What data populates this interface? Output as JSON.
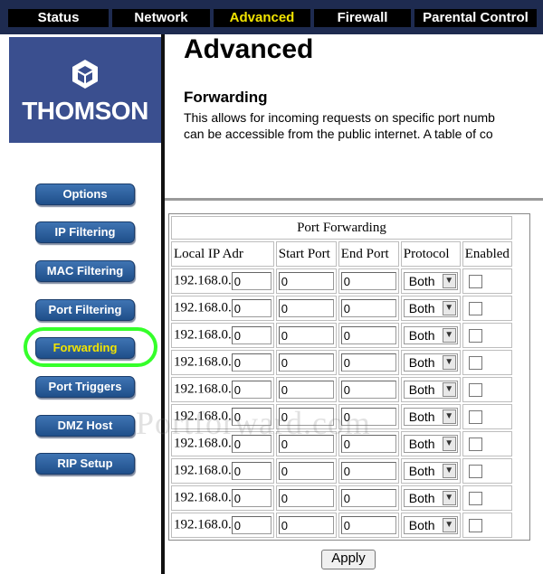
{
  "topnav": {
    "tabs": [
      {
        "label": "Status",
        "active": false
      },
      {
        "label": "Network",
        "active": false
      },
      {
        "label": "Advanced",
        "active": true
      },
      {
        "label": "Firewall",
        "active": false
      },
      {
        "label": "Parental Control",
        "active": false
      }
    ],
    "active_color": "#f2e400"
  },
  "brand": {
    "name": "THOMSON"
  },
  "sidebar": {
    "items": [
      {
        "label": "Options"
      },
      {
        "label": "IP Filtering"
      },
      {
        "label": "MAC Filtering"
      },
      {
        "label": "Port Filtering"
      },
      {
        "label": "Forwarding",
        "current": true
      },
      {
        "label": "Port Triggers"
      },
      {
        "label": "DMZ Host"
      },
      {
        "label": "RIP Setup"
      }
    ]
  },
  "main": {
    "title": "Advanced",
    "section_title": "Forwarding",
    "description_line1": "This allows for incoming requests on specific port numb",
    "description_line2": "can be accessible from the public internet.  A table of co"
  },
  "table": {
    "caption": "Port Forwarding",
    "headers": [
      "Local IP Adr",
      "Start Port",
      "End Port",
      "Protocol",
      "Enabled"
    ],
    "ip_prefix": "192.168.0.",
    "rows": [
      {
        "ip_last": "0",
        "start": "0",
        "end": "0",
        "protocol": "Both",
        "enabled": false
      },
      {
        "ip_last": "0",
        "start": "0",
        "end": "0",
        "protocol": "Both",
        "enabled": false
      },
      {
        "ip_last": "0",
        "start": "0",
        "end": "0",
        "protocol": "Both",
        "enabled": false
      },
      {
        "ip_last": "0",
        "start": "0",
        "end": "0",
        "protocol": "Both",
        "enabled": false
      },
      {
        "ip_last": "0",
        "start": "0",
        "end": "0",
        "protocol": "Both",
        "enabled": false
      },
      {
        "ip_last": "0",
        "start": "0",
        "end": "0",
        "protocol": "Both",
        "enabled": false
      },
      {
        "ip_last": "0",
        "start": "0",
        "end": "0",
        "protocol": "Both",
        "enabled": false
      },
      {
        "ip_last": "0",
        "start": "0",
        "end": "0",
        "protocol": "Both",
        "enabled": false
      },
      {
        "ip_last": "0",
        "start": "0",
        "end": "0",
        "protocol": "Both",
        "enabled": false
      },
      {
        "ip_last": "0",
        "start": "0",
        "end": "0",
        "protocol": "Both",
        "enabled": false
      }
    ]
  },
  "actions": {
    "apply_label": "Apply"
  },
  "watermark": "Portforward.com",
  "colors": {
    "nav_bg": "#1e2b50",
    "logo_bg": "#3a4f8f",
    "button_blue": "#2b5f9e",
    "highlight_green": "#35ff2a"
  }
}
